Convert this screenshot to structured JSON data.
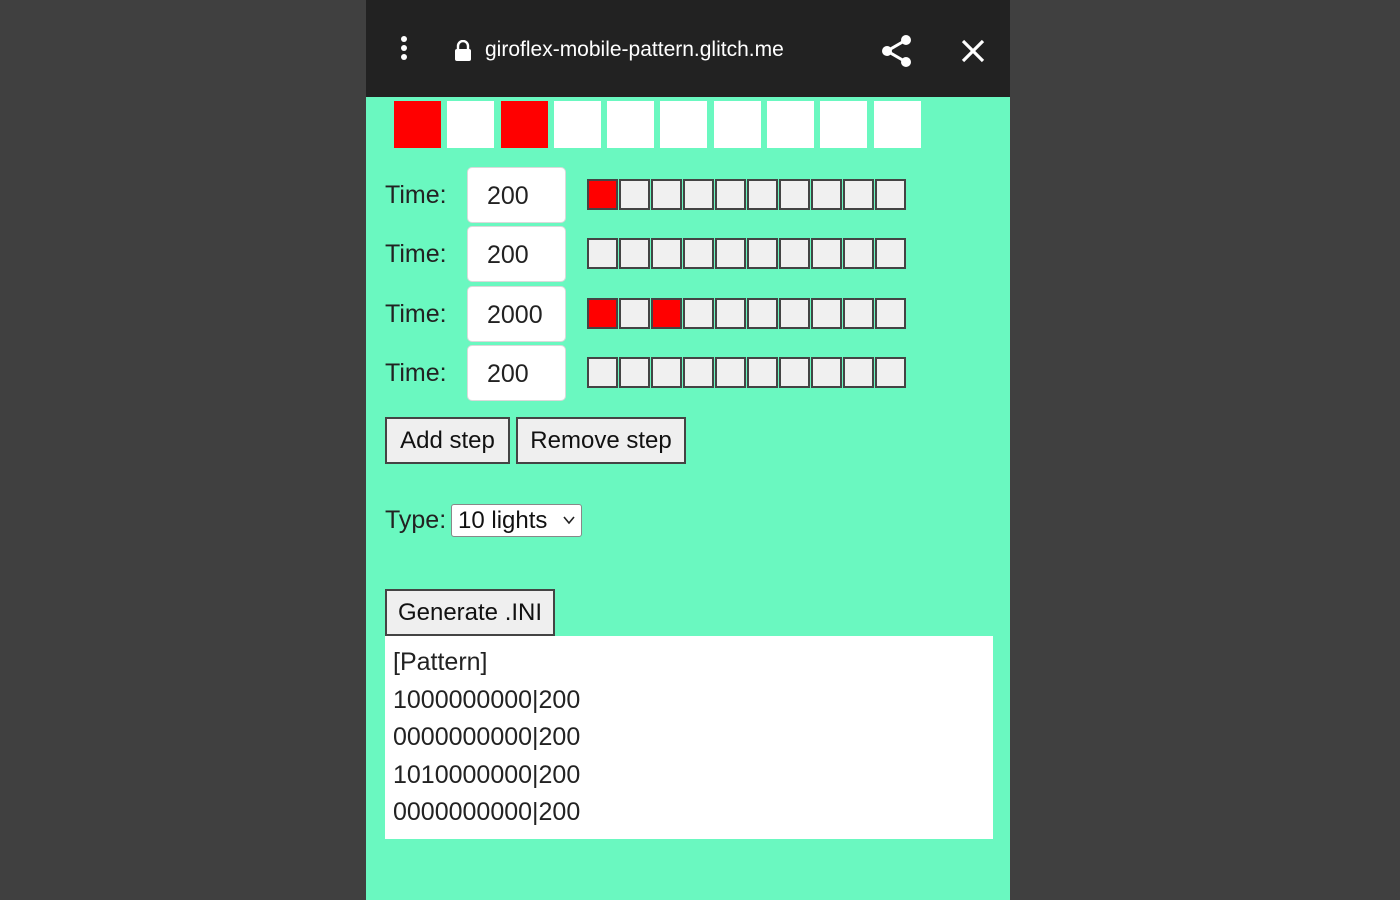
{
  "browser": {
    "url": "giroflex-mobile-pattern.glitch.me",
    "icons": [
      "menu-dots-icon",
      "lock-icon",
      "share-icon",
      "close-icon"
    ]
  },
  "colors": {
    "page_bg": "#404040",
    "app_bg": "#6af8c0",
    "topbar_bg": "#222222",
    "light_on": "#ff0000",
    "light_off_preview": "#ffffff",
    "light_off_step": "#f0f0f0"
  },
  "preview": {
    "lights": [
      1,
      0,
      1,
      0,
      0,
      0,
      0,
      0,
      0,
      0
    ]
  },
  "steps": [
    {
      "label": "Time:",
      "time": "200",
      "lights": [
        1,
        0,
        0,
        0,
        0,
        0,
        0,
        0,
        0,
        0
      ]
    },
    {
      "label": "Time:",
      "time": "200",
      "lights": [
        0,
        0,
        0,
        0,
        0,
        0,
        0,
        0,
        0,
        0
      ]
    },
    {
      "label": "Time:",
      "time": "2000",
      "lights": [
        1,
        0,
        1,
        0,
        0,
        0,
        0,
        0,
        0,
        0
      ]
    },
    {
      "label": "Time:",
      "time": "200",
      "lights": [
        0,
        0,
        0,
        0,
        0,
        0,
        0,
        0,
        0,
        0
      ]
    }
  ],
  "buttons": {
    "add_step": "Add step",
    "remove_step": "Remove step",
    "generate": "Generate .INI"
  },
  "type": {
    "label": "Type:",
    "selected": "10 lights"
  },
  "output": {
    "lines": [
      "[Pattern]",
      "1000000000|200",
      "0000000000|200",
      "1010000000|200",
      "0000000000|200"
    ]
  }
}
